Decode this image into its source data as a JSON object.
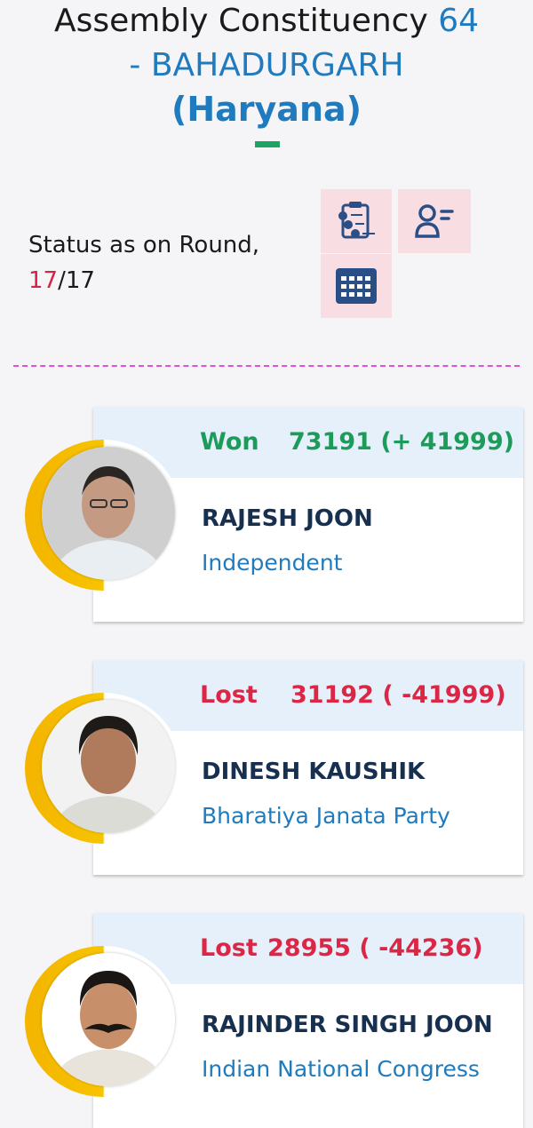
{
  "header": {
    "title_prefix": "Assembly Constituency",
    "constituency_number": "64",
    "constituency_name": "- BAHADURGARH",
    "state": "(Haryana)"
  },
  "status": {
    "label": "Status as on Round,",
    "current_round": "17",
    "total_rounds": "/17"
  },
  "icons": {
    "results": "clipboard-results-icon",
    "candidates": "candidate-list-icon",
    "schedule": "calendar-icon"
  },
  "colors": {
    "won": "#1d9b5a",
    "lost": "#dc2646",
    "accent": "#1f7bbd",
    "name": "#17304f",
    "ring": "#f4b400"
  },
  "candidates": [
    {
      "status": "Won",
      "votes": "73191 (+ 41999)",
      "name": "RAJESH JOON",
      "party": "Independent"
    },
    {
      "status": "Lost",
      "votes": "31192 ( -41999)",
      "name": "DINESH KAUSHIK",
      "party": "Bharatiya Janata Party"
    },
    {
      "status": "Lost",
      "votes": "28955 ( -44236)",
      "name": "RAJINDER SINGH JOON",
      "party": "Indian National Congress"
    }
  ]
}
